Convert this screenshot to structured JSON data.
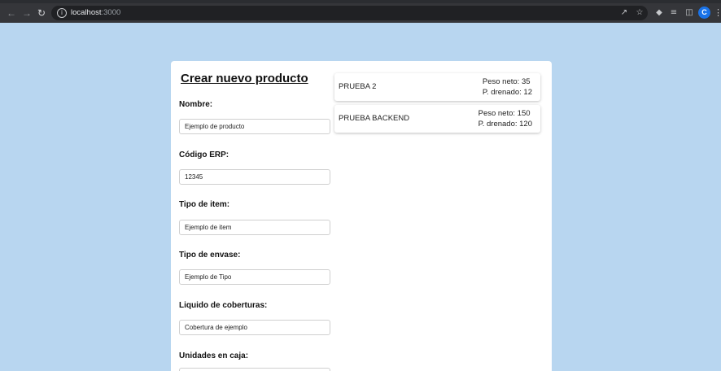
{
  "browser": {
    "url_host": "localhost",
    "url_port": ":3000",
    "profile_initial": "C"
  },
  "form": {
    "title": "Crear nuevo producto",
    "fields": [
      {
        "label": "Nombre:",
        "value": "Ejemplo de producto"
      },
      {
        "label": "Código ERP:",
        "value": "12345"
      },
      {
        "label": "Tipo de item:",
        "value": "Ejemplo de item"
      },
      {
        "label": "Tipo de envase:",
        "value": "Ejemplo de Tipo"
      },
      {
        "label": "Liquido de coberturas:",
        "value": "Cobertura de ejemplo"
      },
      {
        "label": "Unidades en caja:",
        "value": ""
      }
    ]
  },
  "products": [
    {
      "name": "PRUEBA 2",
      "peso_neto": "Peso neto: 35",
      "p_drenado": "P. drenado: 12"
    },
    {
      "name": "PRUEBA BACKEND",
      "peso_neto": "Peso neto: 150",
      "p_drenado": "P. drenado: 120"
    }
  ],
  "colors": {
    "page_background": "#b8d6f0",
    "card_background": "#ffffff",
    "profile_avatar": "#1a73e8"
  },
  "icons": [
    "back-icon",
    "forward-icon",
    "reload-icon",
    "info-icon",
    "share-icon",
    "star-icon",
    "extensions-icon",
    "media-queue-icon",
    "side-panel-icon",
    "menu-icon"
  ]
}
